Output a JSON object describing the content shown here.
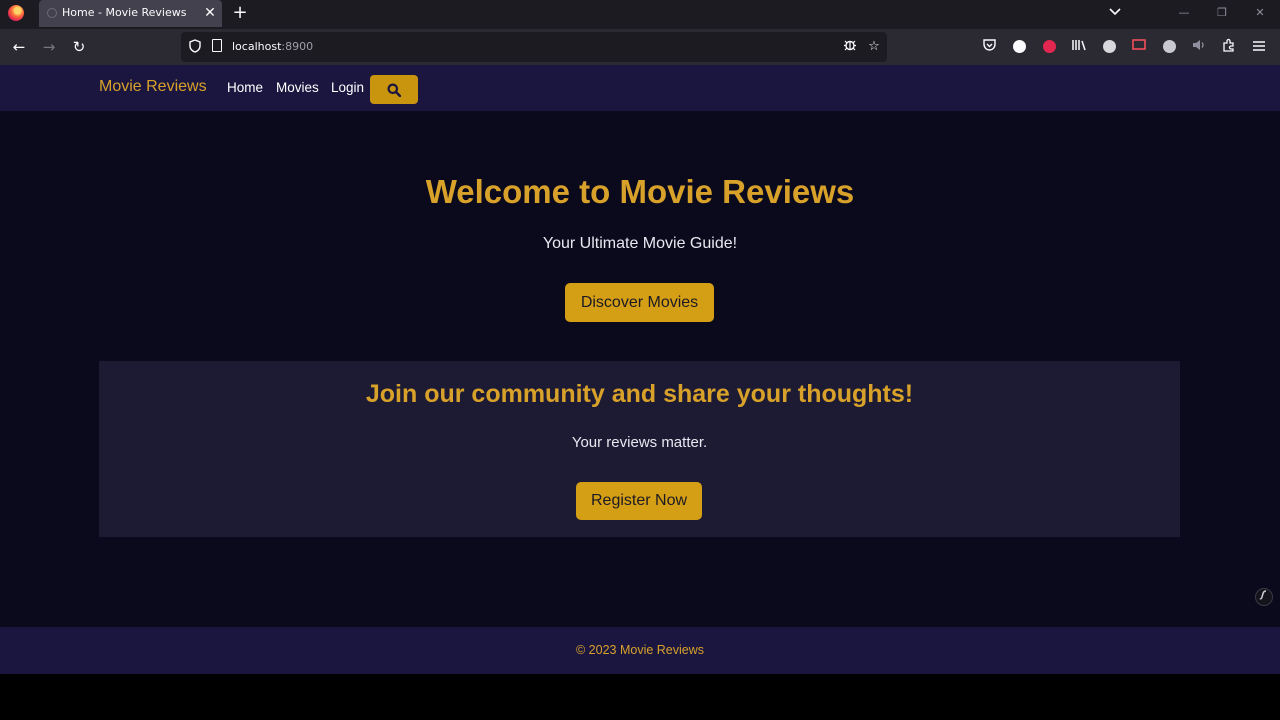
{
  "browser": {
    "tab": {
      "title": "Home - Movie Reviews",
      "close_glyph": "✕"
    },
    "new_tab_glyph": "+",
    "tab_list_glyph": "⌄",
    "window_controls": {
      "minimize": "—",
      "maximize": "❐",
      "close": "✕"
    },
    "nav": {
      "back": "←",
      "forward": "→",
      "reload": "↻"
    },
    "url": {
      "host": "localhost",
      "port": ":8900"
    },
    "icons": {
      "url_actions": [
        "bug-icon",
        "star-icon"
      ],
      "toolbar": [
        "pocket-icon",
        "info-extension-icon",
        "red-extension-icon",
        "library-icon",
        "circle-extension-icon",
        "screen-extension-icon",
        "adblock-icon",
        "speaker-icon",
        "extensions-icon",
        "menu-icon"
      ]
    }
  },
  "site": {
    "brand": "Movie Reviews",
    "nav_links": [
      "Home",
      "Movies",
      "Login"
    ],
    "hero": {
      "title": "Welcome to Movie Reviews",
      "subtitle": "Your Ultimate Movie Guide!",
      "button": "Discover Movies"
    },
    "community": {
      "title": "Join our community and share your thoughts!",
      "subtitle": "Your reviews matter.",
      "button": "Register Now"
    },
    "footer": "© 2023 Movie Reviews"
  },
  "colors": {
    "accent": "#d49f14",
    "brand_text": "#d8a12a",
    "nav_bg": "#1b1640",
    "page_bg": "#0b0a1c",
    "card_bg": "#1d1b33"
  }
}
